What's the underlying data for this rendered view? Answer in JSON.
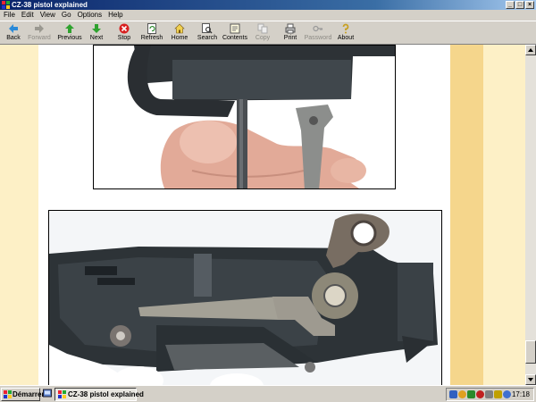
{
  "window": {
    "title": "CZ-38 pistol explained",
    "controls": [
      "_",
      "□",
      "×"
    ]
  },
  "menu": [
    "File",
    "Edit",
    "View",
    "Go",
    "Options",
    "Help"
  ],
  "toolbar": {
    "back": "Back",
    "forward": "Forward",
    "previous": "Previous",
    "next": "Next",
    "stop": "Stop",
    "refresh": "Refresh",
    "home": "Home",
    "search": "Search",
    "contents": "Contents",
    "copy": "Copy",
    "print": "Print",
    "password": "Password",
    "about": "About"
  },
  "taskbar": {
    "start_label": "Démarrer",
    "task_label": "CZ-38 pistol explained",
    "clock": "17:18"
  },
  "colors": {
    "title_bar": "#0a246a",
    "page_background": "#fff6dc",
    "side_band": "#f5d68c"
  }
}
